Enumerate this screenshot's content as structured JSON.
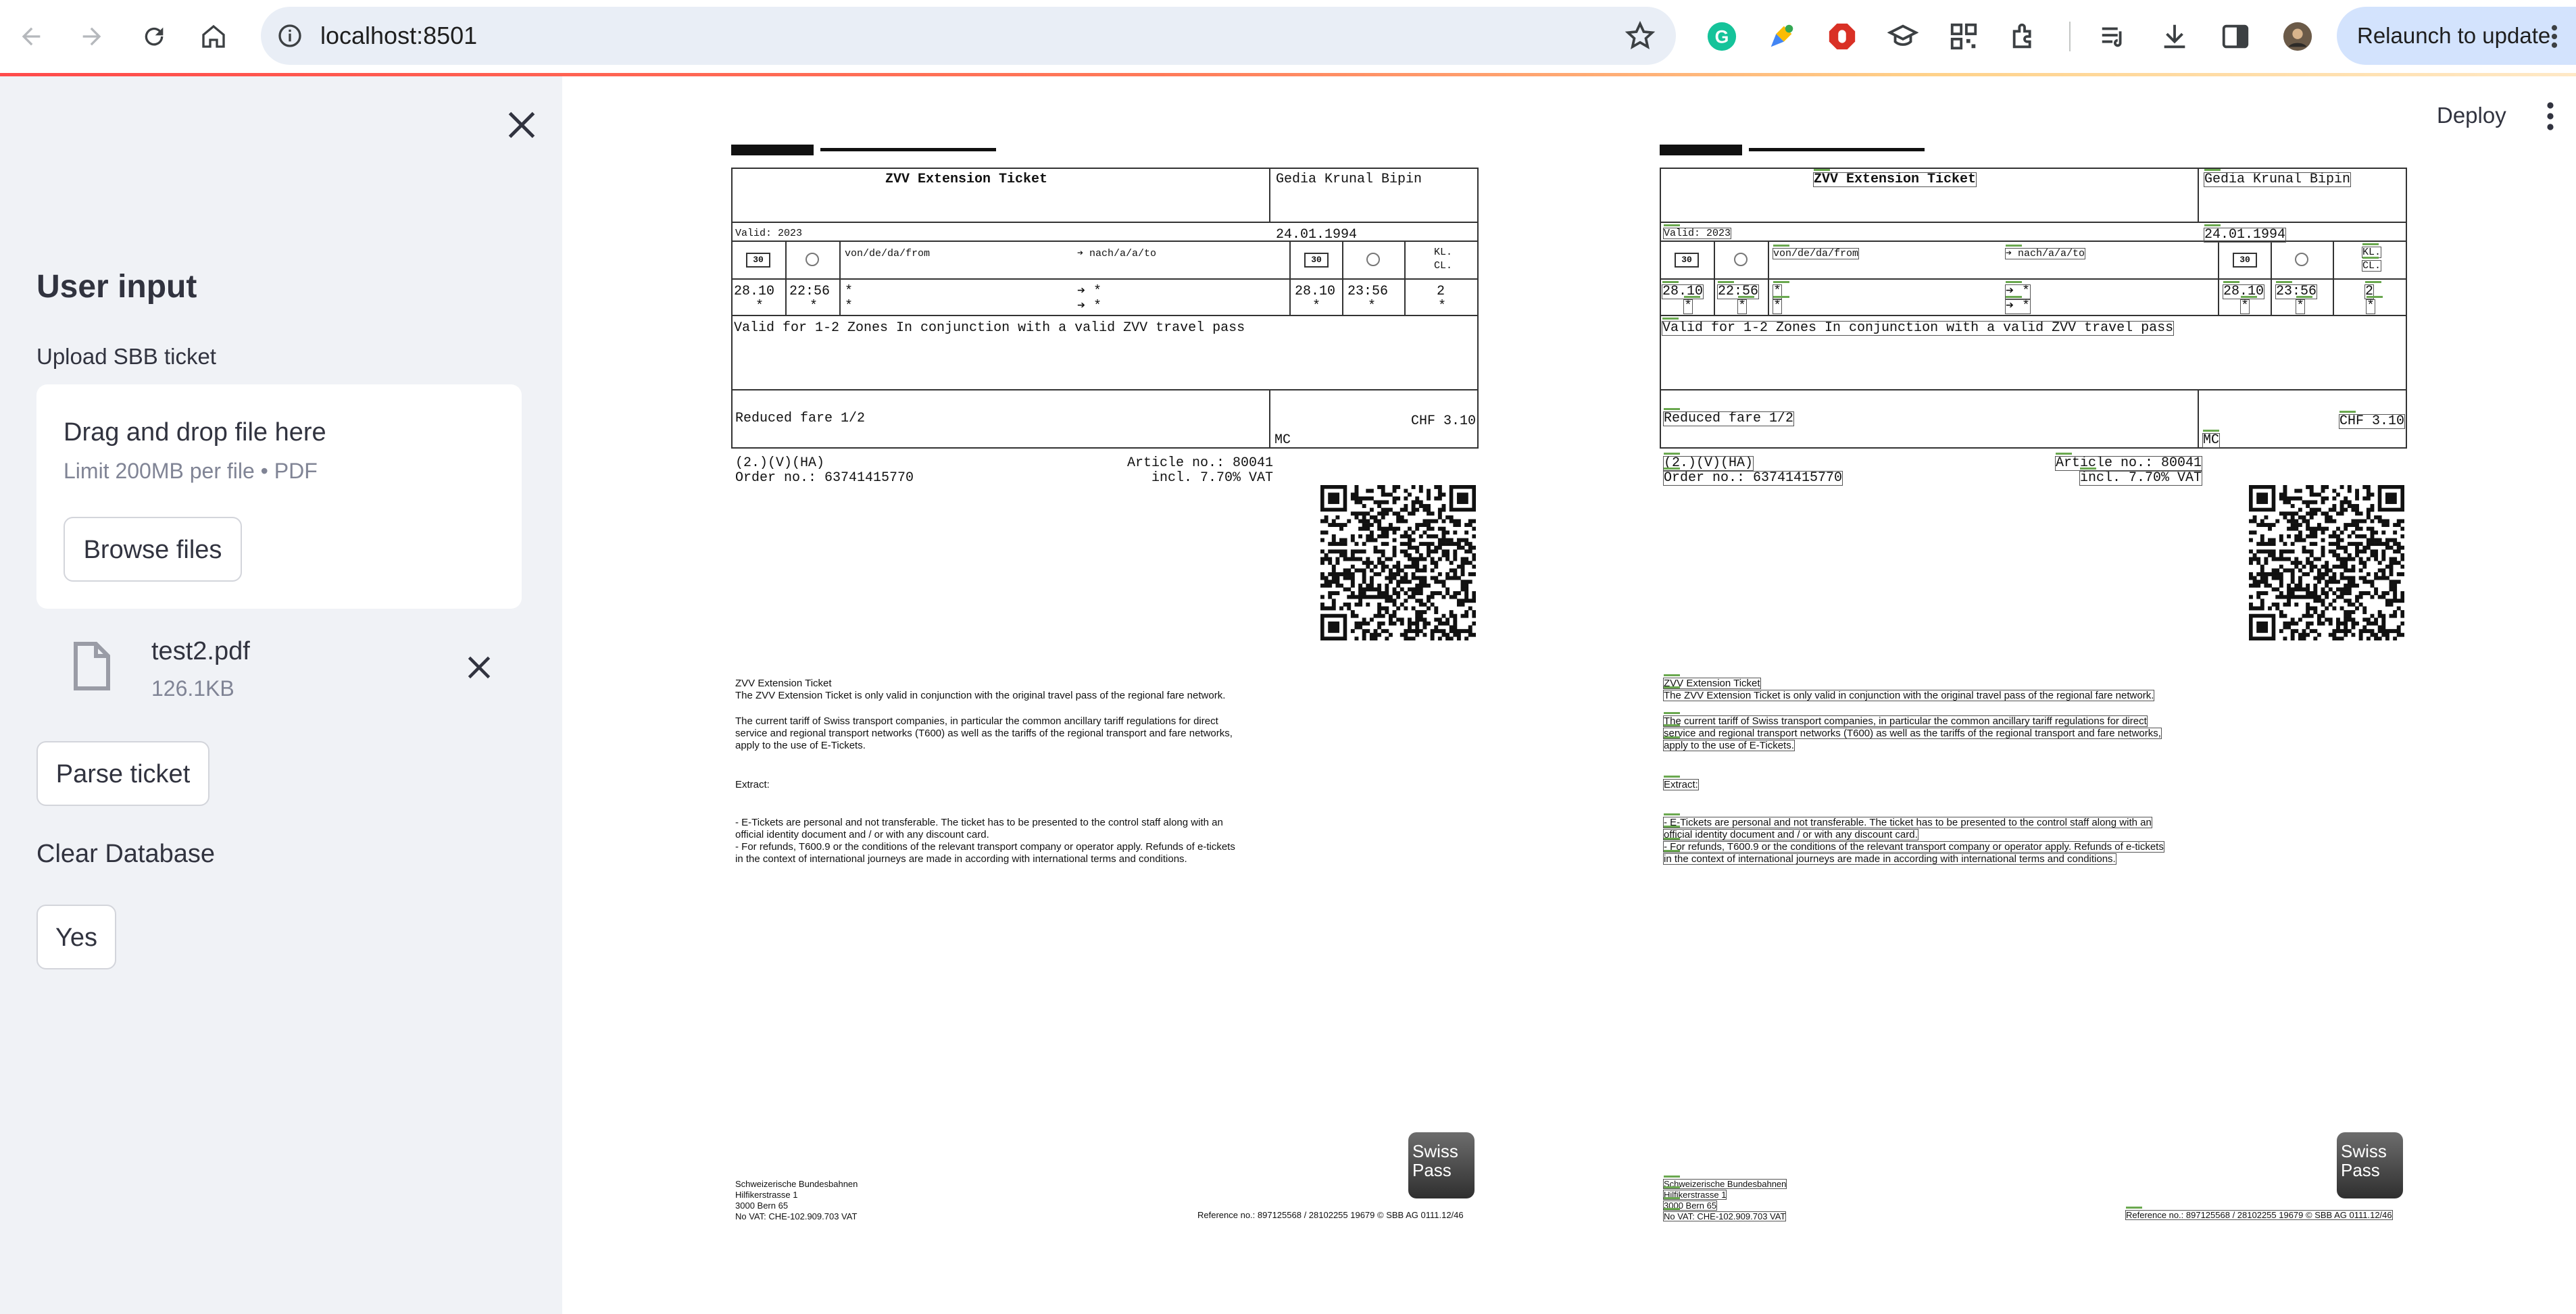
{
  "browser": {
    "url": "localhost:8501",
    "relaunch_label": "Relaunch to update"
  },
  "sidebar": {
    "title": "User input",
    "upload_label": "Upload SBB ticket",
    "dropzone": {
      "main_text": "Drag and drop file here",
      "limit_text": "Limit 200MB per file • PDF",
      "browse_label": "Browse files"
    },
    "uploaded_file": {
      "name": "test2.pdf",
      "size": "126.1KB"
    },
    "parse_button": "Parse ticket",
    "clear_db_label": "Clear Database",
    "yes_button": "Yes"
  },
  "main": {
    "deploy_label": "Deploy"
  },
  "ticket": {
    "title": "ZVV Extension Ticket",
    "holder": "Gedia Krunal Bipin",
    "valid": "Valid: 2023",
    "birthdate": "24.01.1994",
    "icon_30": "30",
    "from_header": "von/de/da/from",
    "to_header": "➔ nach/a/a/to",
    "class_header_1": "KL.",
    "class_header_2": "CL.",
    "date_from": "28.10",
    "time_from": "22:56",
    "star": "*",
    "arrow_star": "➔ *",
    "date_to": "28.10",
    "time_to": "23:56",
    "class_value": "2",
    "validity_text": "Valid for 1-2 Zones In conjunction with a valid ZVV travel pass",
    "fare": "Reduced fare 1/2",
    "mc": "MC",
    "price": "CHF 3.10",
    "codes": "(2.)(V)(HA)",
    "order_no": "Order no.: 63741415770",
    "article_no": "Article no.: 80041",
    "vat": "incl. 7.70% VAT",
    "terms_title": "ZVV Extension Ticket",
    "terms_line1": "The ZVV Extension Ticket is only valid in conjunction with the original travel pass of the regional fare network.",
    "terms_p2_1": "The current tariff of Swiss transport companies, in particular the common ancillary tariff regulations for direct",
    "terms_p2_2": "service and regional transport networks (T600) as well as the tariffs of the regional transport and fare networks,",
    "terms_p2_3": "apply to the use of E-Tickets.",
    "extract": "Extract:",
    "bullet1_1": "-    E-Tickets are personal and not transferable. The ticket has to be presented to the control staff along with an",
    "bullet1_2": "official identity document and / or with any discount card.",
    "bullet2_1": "-    For refunds, T600.9 or the conditions of the relevant transport company or operator apply. Refunds of e-tickets",
    "bullet2_2": "in the context of international journeys are made in according with international terms and conditions.",
    "swisspass_1": "Swiss",
    "swisspass_2": "Pass",
    "company": "Schweizerische Bundesbahnen",
    "street": "Hilfikerstrasse 1",
    "city": "3000 Bern 65",
    "vat_no": "No VAT: CHE-102.909.703 VAT",
    "reference": "Reference no.: 897125568 / 28102255 19679 © SBB AG 0111.12/46"
  }
}
